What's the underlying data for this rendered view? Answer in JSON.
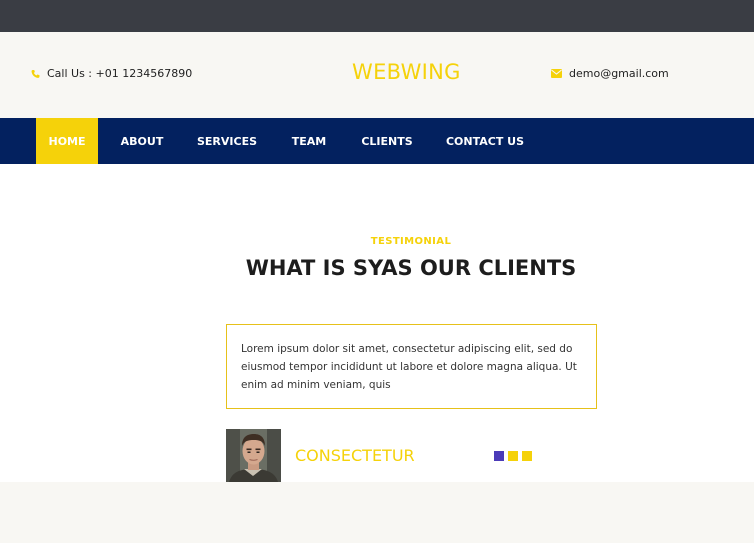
{
  "header": {
    "phone_text": "Call Us : +01 1234567890",
    "phone_icon": "phone-icon",
    "logo": "WEBWING",
    "email_text": "demo@gmail.com",
    "email_icon": "envelope-icon"
  },
  "nav": {
    "items": [
      {
        "label": "HOME",
        "active": true
      },
      {
        "label": "ABOUT",
        "active": false
      },
      {
        "label": "SERVICES",
        "active": false
      },
      {
        "label": "TEAM",
        "active": false
      },
      {
        "label": "CLIENTS",
        "active": false
      },
      {
        "label": "CONTACT US",
        "active": false
      }
    ]
  },
  "testimonial": {
    "subtitle": "TESTIMONIAL",
    "title": "WHAT IS SYAS OUR CLIENTS",
    "quote": "Lorem ipsum dolor sit amet, consectetur adipiscing elit, sed do eiusmod tempor incididunt ut labore et dolore magna aliqua. Ut enim ad minim veniam, quis",
    "client_name": "CONSECTETUR",
    "slider_dots": [
      "#4b3bb8",
      "#f5d20a",
      "#f5d20a"
    ]
  },
  "colors": {
    "accent": "#f5d20a",
    "nav_bg": "#03215f",
    "topbar": "#3a3d44",
    "header_bg": "#f8f7f3"
  }
}
